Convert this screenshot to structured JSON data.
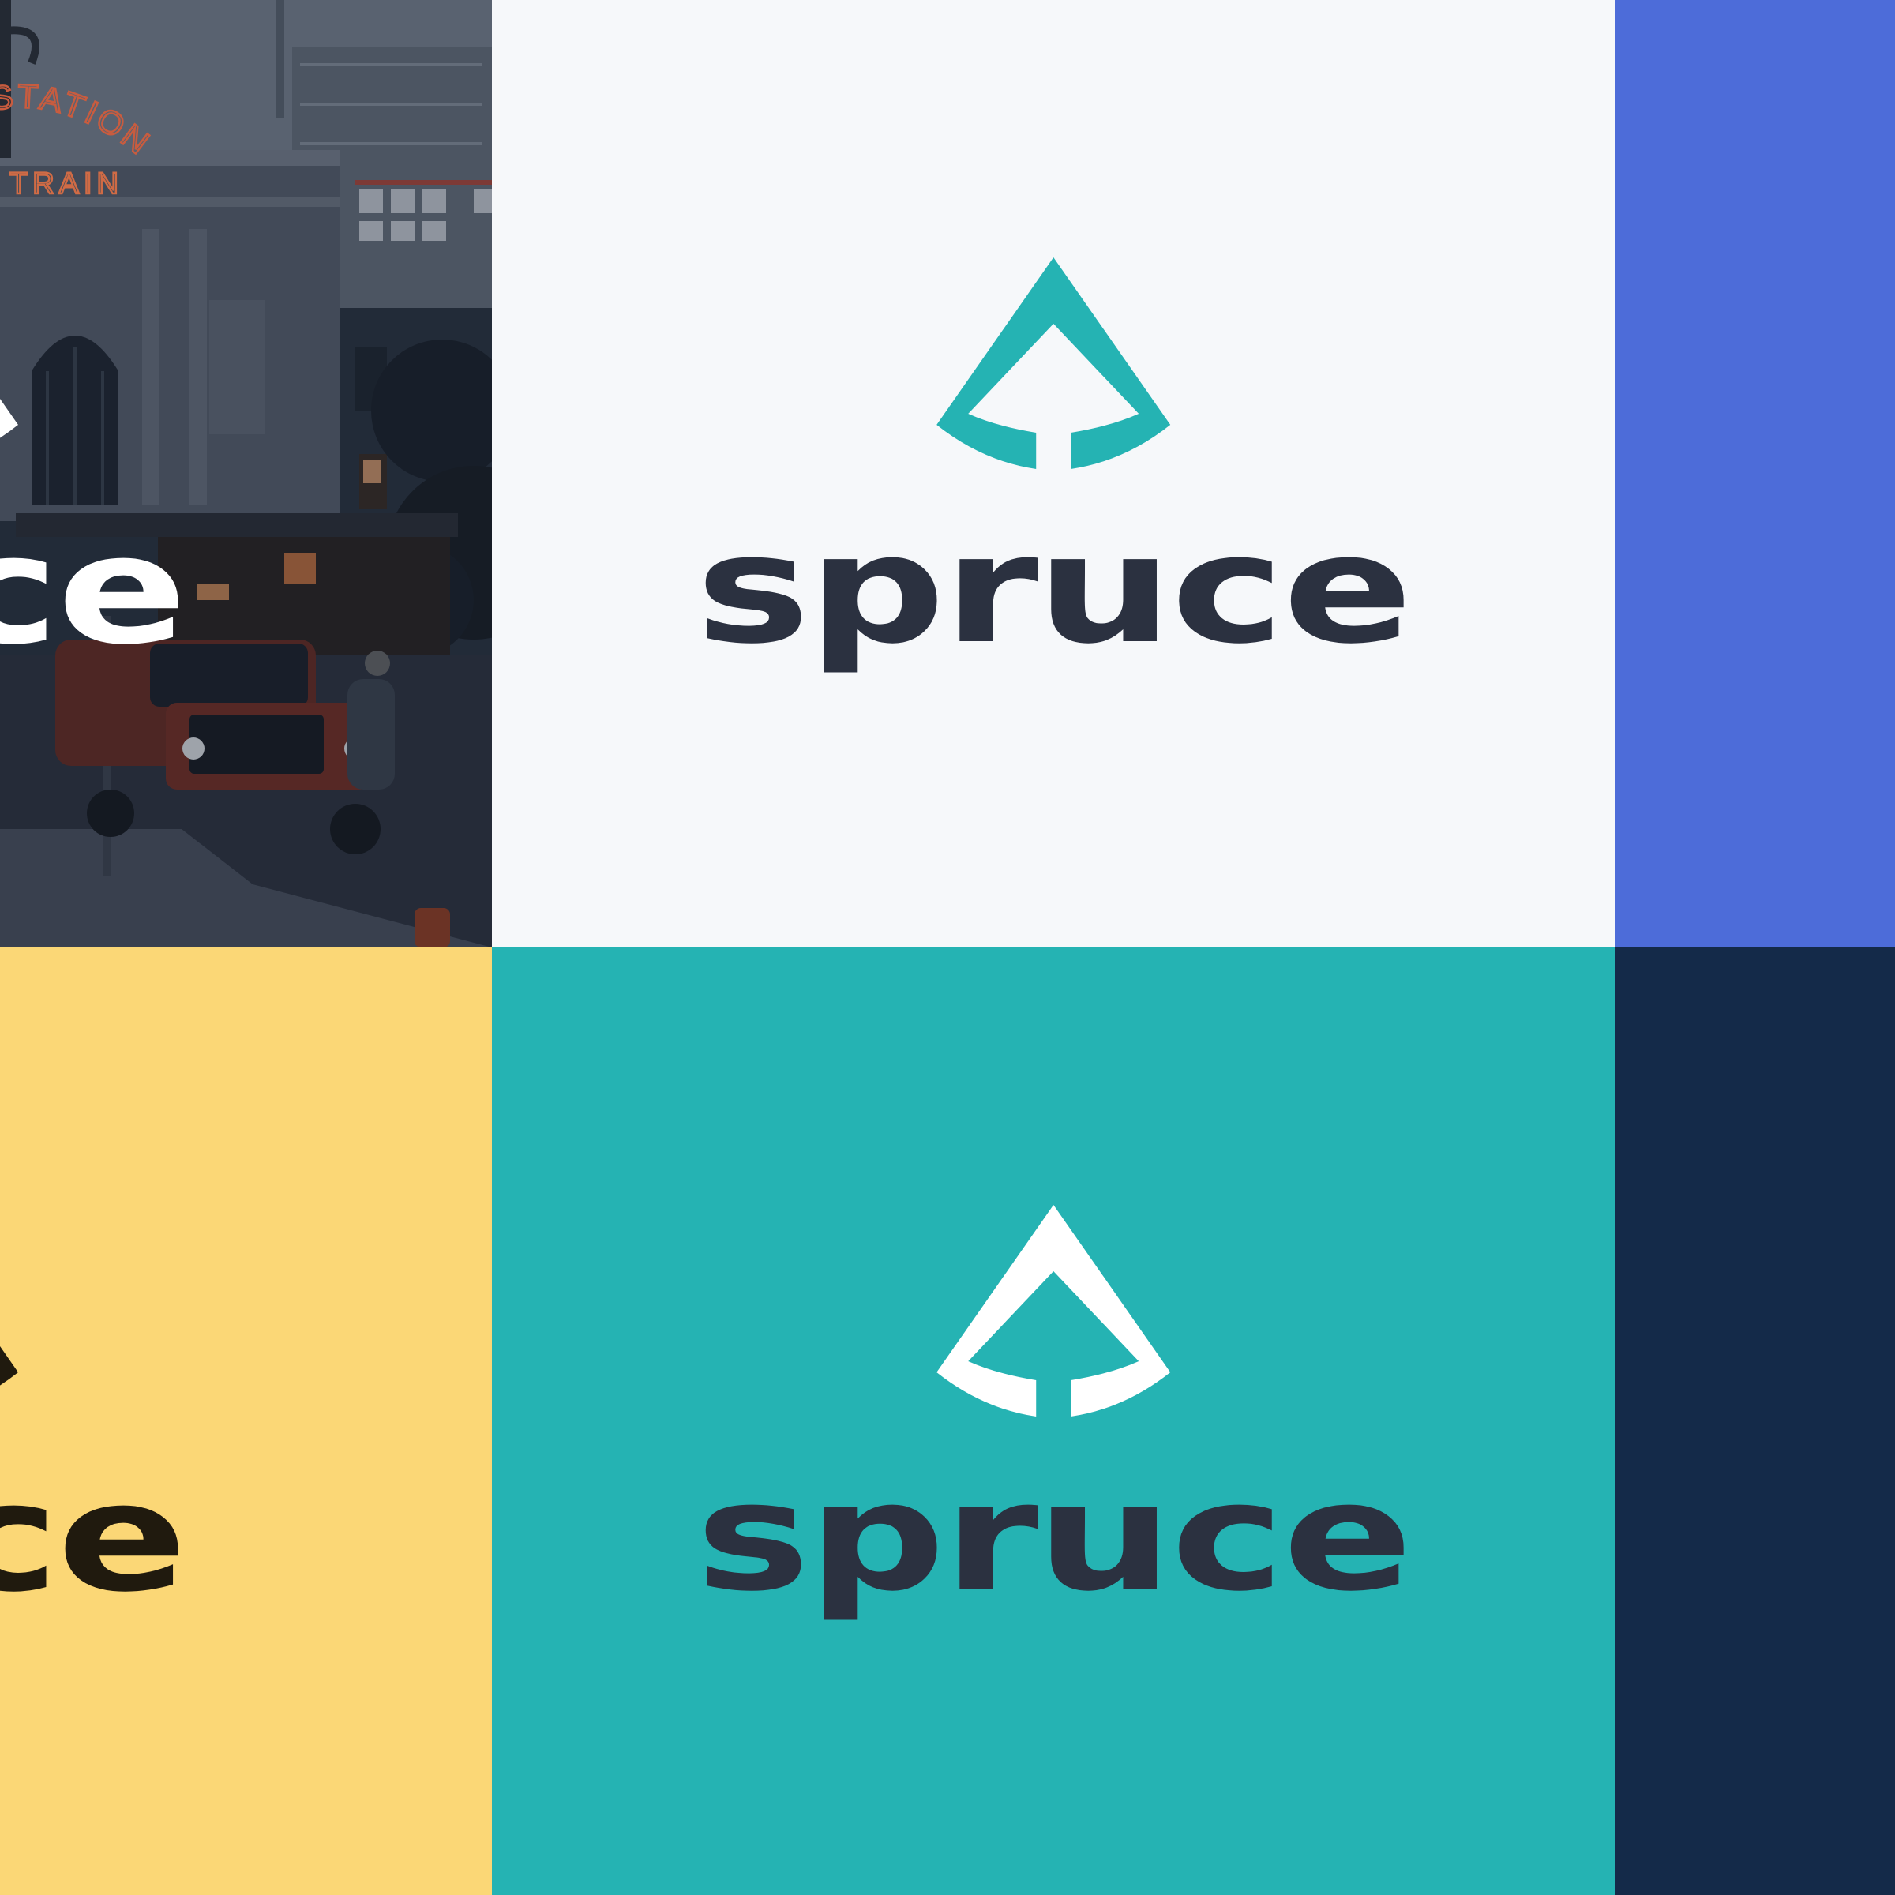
{
  "brand": {
    "name": "spruce",
    "colors": {
      "teal": "#25b3b3",
      "ink": "#2b3140",
      "light_bg": "#f6f8fa",
      "blue": "#4d6cd9",
      "yellow": "#fbd776",
      "navy": "#142a49",
      "dark_ink": "#201a0e",
      "white": "#ffffff"
    }
  },
  "tiles": {
    "photo": {
      "sign_top": "STATION",
      "sign_bottom": "TRAIN",
      "wordmark_fragment": "spruce",
      "icon": "spruce-tree-mark-icon"
    },
    "light": {
      "wordmark": "spruce",
      "icon": "spruce-tree-mark-icon"
    },
    "yellow": {
      "wordmark_fragment": "spruce",
      "icon": "spruce-tree-mark-icon"
    },
    "teal": {
      "wordmark": "spruce",
      "icon": "spruce-tree-mark-icon"
    }
  }
}
